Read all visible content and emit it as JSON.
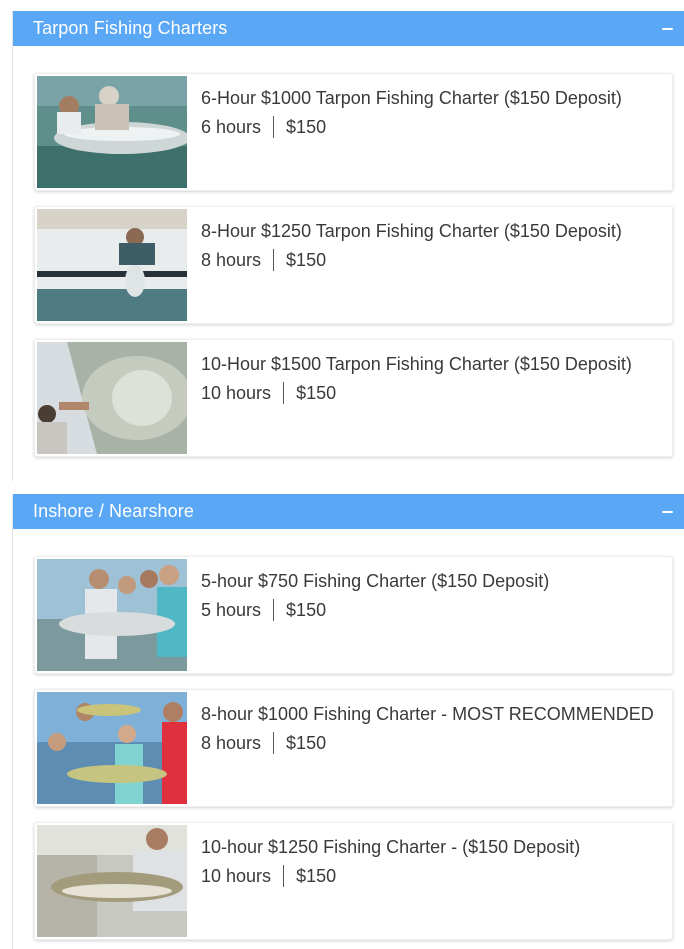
{
  "colors": {
    "header_bg": "#5aa7f5",
    "header_text": "#ffffff",
    "text": "#3a3a3a"
  },
  "sections": [
    {
      "title": "Tarpon Fishing Charters",
      "collapse_icon": "minus-icon",
      "items": [
        {
          "title": "6-Hour $1000 Tarpon Fishing Charter ($150 Deposit)",
          "duration": "6 hours",
          "price": "$150",
          "image": "tarpon-catch-photo"
        },
        {
          "title": "8-Hour $1250 Tarpon Fishing Charter ($150 Deposit)",
          "duration": "8 hours",
          "price": "$150",
          "image": "tarpon-boatside-photo"
        },
        {
          "title": "10-Hour $1500 Tarpon Fishing Charter ($150 Deposit)",
          "duration": "10 hours",
          "price": "$150",
          "image": "tarpon-closeup-photo"
        }
      ]
    },
    {
      "title": "Inshore / Nearshore",
      "collapse_icon": "minus-icon",
      "items": [
        {
          "title": "5-hour $750 Fishing Charter ($150 Deposit)",
          "duration": "5 hours",
          "price": "$150",
          "image": "group-with-fish-photo"
        },
        {
          "title": "8-hour $1000 Fishing Charter - MOST RECOMMENDED",
          "duration": "8 hours",
          "price": "$150",
          "image": "family-with-fish-photo"
        },
        {
          "title": "10-hour $1250 Fishing Charter - ($150 Deposit)",
          "duration": "10 hours",
          "price": "$150",
          "image": "snook-photo"
        }
      ]
    }
  ]
}
